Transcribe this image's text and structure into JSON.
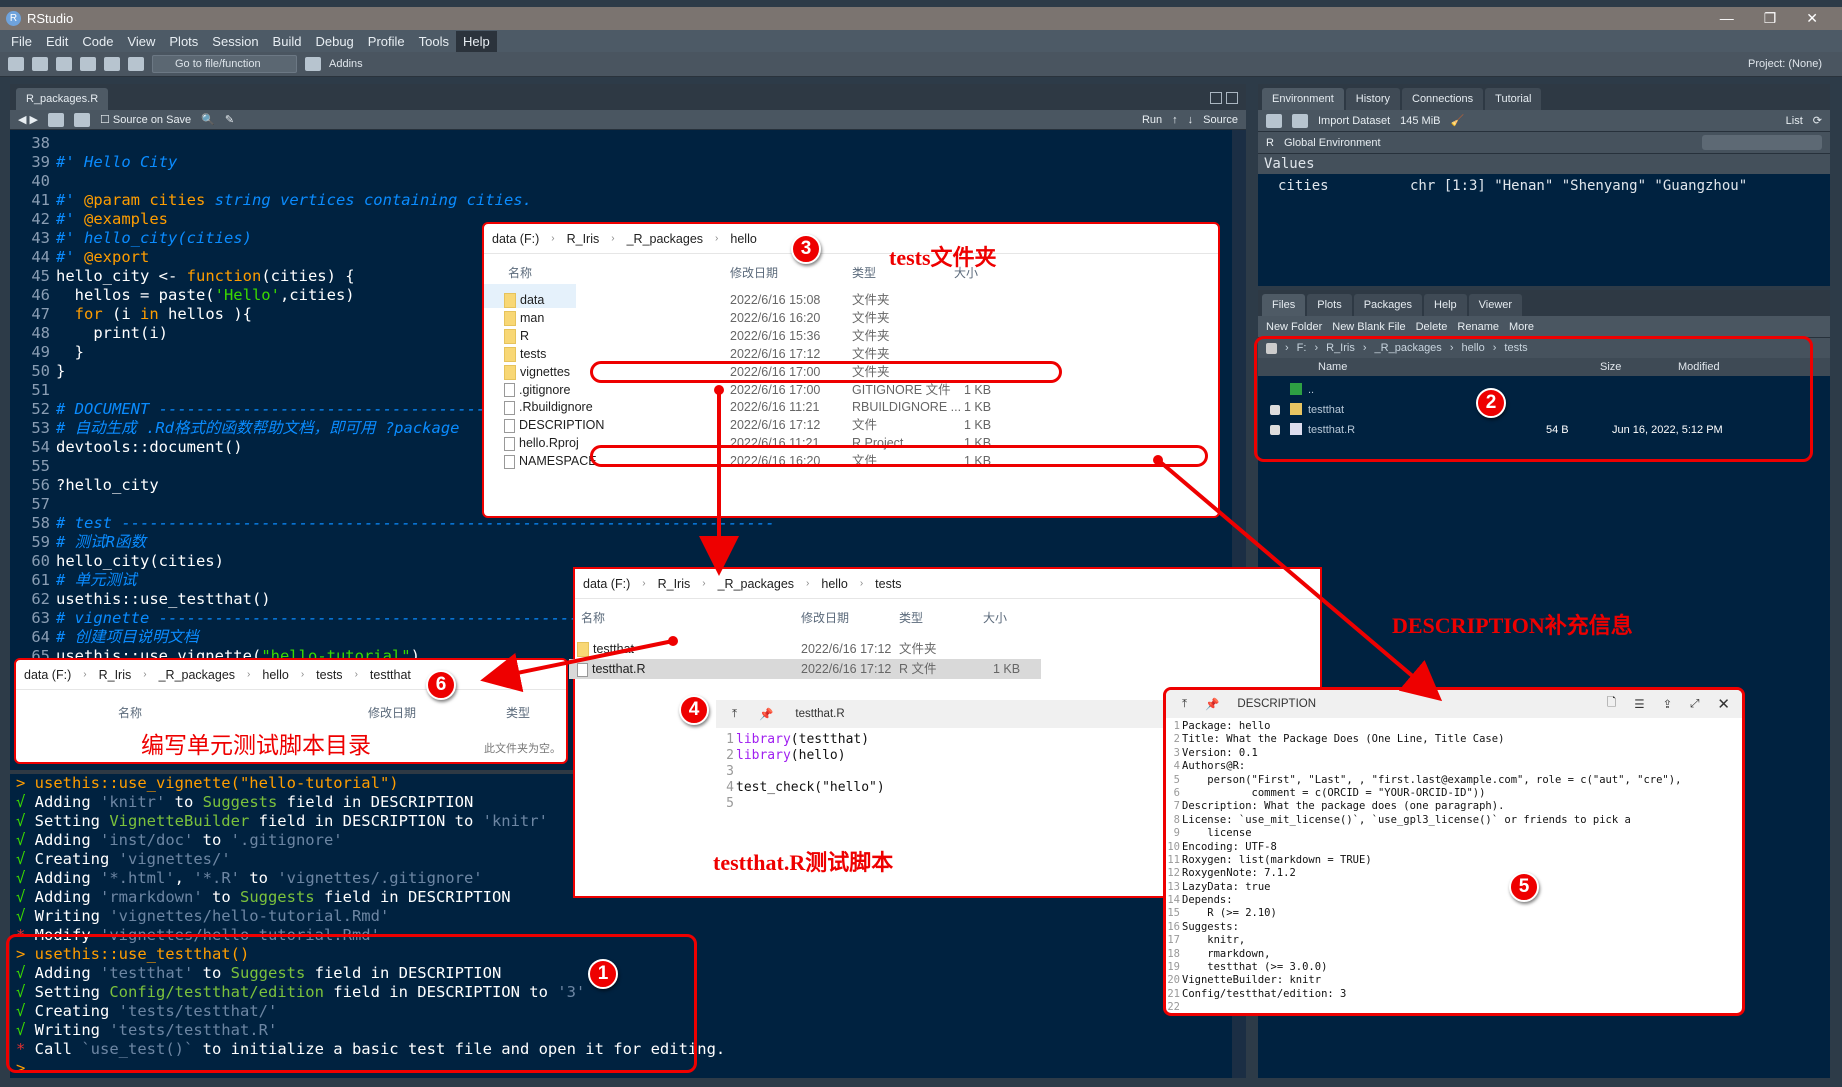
{
  "window": {
    "title": "RStudio",
    "controls": [
      "—",
      "❐",
      "✕"
    ]
  },
  "menu": [
    "File",
    "Edit",
    "Code",
    "View",
    "Plots",
    "Session",
    "Build",
    "Debug",
    "Profile",
    "Tools",
    "Help"
  ],
  "toolbar": {
    "goto": "Go to file/function",
    "addins": "Addins",
    "project": "Project: (None)"
  },
  "editor": {
    "tab": "R_packages.R",
    "source_on_save": "Source on Save",
    "run": "Run",
    "source": "Source",
    "first_line": 38,
    "lines": [
      [],
      [
        [
          "cm",
          "#' Hello City"
        ]
      ],
      [],
      [
        [
          "cm",
          "#' "
        ],
        [
          "tag",
          "@param cities"
        ],
        [
          "cm",
          " string vertices containing cities."
        ]
      ],
      [
        [
          "cm",
          "#' "
        ],
        [
          "tag",
          "@examples"
        ]
      ],
      [
        [
          "cm",
          "#' hello_city(cities)"
        ]
      ],
      [
        [
          "cm",
          "#' "
        ],
        [
          "tag",
          "@export"
        ]
      ],
      [
        [
          "pl",
          "hello_city <- "
        ],
        [
          "kw",
          "function"
        ],
        [
          "pl",
          "(cities) {"
        ]
      ],
      [
        [
          "pl",
          "  hellos = paste("
        ],
        [
          "str",
          "'Hello'"
        ],
        [
          "pl",
          ",cities)"
        ]
      ],
      [
        [
          "pl",
          "  "
        ],
        [
          "kw",
          "for"
        ],
        [
          "pl",
          " (i "
        ],
        [
          "kw",
          "in"
        ],
        [
          "pl",
          " hellos ){"
        ]
      ],
      [
        [
          "pl",
          "    print(i)"
        ]
      ],
      [
        [
          "pl",
          "  }"
        ]
      ],
      [
        [
          "pl",
          "}"
        ]
      ],
      [],
      [
        [
          "cm",
          "# DOCUMENT ------------------------------------------------------------------"
        ]
      ],
      [
        [
          "cm",
          "# 自动生成 .Rd格式的函数帮助文档，即可用 ?package"
        ]
      ],
      [
        [
          "pl",
          "devtools::document()"
        ]
      ],
      [],
      [
        [
          "pl",
          "?hello_city"
        ]
      ],
      [],
      [
        [
          "cm",
          "# test ----------------------------------------------------------------------"
        ]
      ],
      [
        [
          "cm",
          "# 测试R函数"
        ]
      ],
      [
        [
          "pl",
          "hello_city(cities)"
        ]
      ],
      [
        [
          "cm",
          "# 单元测试"
        ]
      ],
      [
        [
          "pl",
          "usethis::use_testthat()"
        ]
      ],
      [
        [
          "cm",
          "# vignette ------------------------------------------------------------------"
        ]
      ],
      [
        [
          "cm",
          "# 创建项目说明文档"
        ]
      ],
      [
        [
          "pl",
          "usethis::use_vignette("
        ],
        [
          "str",
          "\"hello-tutorial\""
        ],
        [
          "pl",
          ")"
        ]
      ]
    ]
  },
  "console": {
    "lines": [
      [
        [
          "prompt",
          "> usethis::use_vignette(\"hello-tutorial\")"
        ]
      ],
      [
        [
          "ok",
          "√ "
        ],
        [
          "pl",
          "Adding "
        ],
        [
          "q",
          "'knitr'"
        ],
        [
          "pl",
          " to "
        ],
        [
          "gr",
          "Suggests"
        ],
        [
          "pl",
          " field in DESCRIPTION"
        ]
      ],
      [
        [
          "ok",
          "√ "
        ],
        [
          "pl",
          "Setting "
        ],
        [
          "gr",
          "VignetteBuilder"
        ],
        [
          "pl",
          " field in DESCRIPTION to "
        ],
        [
          "q",
          "'knitr'"
        ]
      ],
      [
        [
          "ok",
          "√ "
        ],
        [
          "pl",
          "Adding "
        ],
        [
          "q",
          "'inst/doc'"
        ],
        [
          "pl",
          " to "
        ],
        [
          "q",
          "'.gitignore'"
        ]
      ],
      [
        [
          "ok",
          "√ "
        ],
        [
          "pl",
          "Creating "
        ],
        [
          "q",
          "'vignettes/'"
        ]
      ],
      [
        [
          "ok",
          "√ "
        ],
        [
          "pl",
          "Adding "
        ],
        [
          "q",
          "'*.html'"
        ],
        [
          "pl",
          ", "
        ],
        [
          "q",
          "'*.R'"
        ],
        [
          "pl",
          " to "
        ],
        [
          "q",
          "'vignettes/.gitignore'"
        ]
      ],
      [
        [
          "ok",
          "√ "
        ],
        [
          "pl",
          "Adding "
        ],
        [
          "q",
          "'rmarkdown'"
        ],
        [
          "pl",
          " to "
        ],
        [
          "gr",
          "Suggests"
        ],
        [
          "pl",
          " field in DESCRIPTION"
        ]
      ],
      [
        [
          "ok",
          "√ "
        ],
        [
          "pl",
          "Writing "
        ],
        [
          "q",
          "'vignettes/hello-tutorial.Rmd'"
        ]
      ],
      [
        [
          "star",
          "* "
        ],
        [
          "pl",
          "Modify "
        ],
        [
          "q",
          "'vignettes/hello-tutorial.Rmd'"
        ]
      ],
      [
        [
          "prompt",
          "> usethis::use_testthat()"
        ]
      ],
      [
        [
          "ok",
          "√ "
        ],
        [
          "pl",
          "Adding "
        ],
        [
          "q",
          "'testthat'"
        ],
        [
          "pl",
          " to "
        ],
        [
          "gr",
          "Suggests"
        ],
        [
          "pl",
          " field in DESCRIPTION"
        ]
      ],
      [
        [
          "ok",
          "√ "
        ],
        [
          "pl",
          "Setting "
        ],
        [
          "gr",
          "Config/testthat/edition"
        ],
        [
          "pl",
          " field in DESCRIPTION to "
        ],
        [
          "q",
          "'3'"
        ]
      ],
      [
        [
          "ok",
          "√ "
        ],
        [
          "pl",
          "Creating "
        ],
        [
          "q",
          "'tests/testthat/'"
        ]
      ],
      [
        [
          "ok",
          "√ "
        ],
        [
          "pl",
          "Writing "
        ],
        [
          "q",
          "'tests/testthat.R'"
        ]
      ],
      [
        [
          "star",
          "* "
        ],
        [
          "pl",
          "Call "
        ],
        [
          "q",
          "`use_test()`"
        ],
        [
          "pl",
          " to initialize a basic test file and open it for editing."
        ]
      ],
      [
        [
          "prompt",
          "> "
        ]
      ]
    ]
  },
  "environment": {
    "tabs": [
      "Environment",
      "History",
      "Connections",
      "Tutorial"
    ],
    "import": "Import Dataset",
    "memory": "145 MiB",
    "view": "List",
    "lang": "R",
    "scope": "Global Environment",
    "section": "Values",
    "var_name": "cities",
    "var_value": "chr [1:3] \"Henan\" \"Shenyang\" \"Guangzhou\""
  },
  "files": {
    "tabs": [
      "Files",
      "Plots",
      "Packages",
      "Help",
      "Viewer"
    ],
    "actions": [
      "New Folder",
      "New Blank File",
      "Delete",
      "Rename",
      "More"
    ],
    "path": [
      "F:",
      "R_Iris",
      "_R_packages",
      "hello",
      "tests"
    ],
    "cols": [
      "Name",
      "Size",
      "Modified"
    ],
    "rows": [
      {
        "name": "..",
        "size": "",
        "modified": ""
      },
      {
        "name": "testthat",
        "size": "",
        "modified": ""
      },
      {
        "name": "testthat.R",
        "size": "54 B",
        "modified": "Jun 16, 2022, 5:12 PM"
      }
    ]
  },
  "explorer3": {
    "path": [
      "data (F:)",
      "R_Iris",
      "_R_packages",
      "hello"
    ],
    "cols": [
      "名称",
      "修改日期",
      "类型",
      "大小"
    ],
    "rows": [
      {
        "name": "data",
        "date": "2022/6/16 15:08",
        "type": "文件夹",
        "size": "",
        "kind": "folder"
      },
      {
        "name": "man",
        "date": "2022/6/16 16:20",
        "type": "文件夹",
        "size": "",
        "kind": "folder"
      },
      {
        "name": "R",
        "date": "2022/6/16 15:36",
        "type": "文件夹",
        "size": "",
        "kind": "folder"
      },
      {
        "name": "tests",
        "date": "2022/6/16 17:12",
        "type": "文件夹",
        "size": "",
        "kind": "folder"
      },
      {
        "name": "vignettes",
        "date": "2022/6/16 17:00",
        "type": "文件夹",
        "size": "",
        "kind": "folder"
      },
      {
        "name": ".gitignore",
        "date": "2022/6/16 17:00",
        "type": "GITIGNORE 文件",
        "size": "1 KB",
        "kind": "file"
      },
      {
        "name": ".Rbuildignore",
        "date": "2022/6/16 11:21",
        "type": "RBUILDIGNORE ...",
        "size": "1 KB",
        "kind": "file"
      },
      {
        "name": "DESCRIPTION",
        "date": "2022/6/16 17:12",
        "type": "文件",
        "size": "1 KB",
        "kind": "file"
      },
      {
        "name": "hello.Rproj",
        "date": "2022/6/16 11:21",
        "type": "R Project",
        "size": "1 KB",
        "kind": "file"
      },
      {
        "name": "NAMESPACE",
        "date": "2022/6/16 16:20",
        "type": "文件",
        "size": "1 KB",
        "kind": "file"
      }
    ]
  },
  "explorer4": {
    "path": [
      "data (F:)",
      "R_Iris",
      "_R_packages",
      "hello",
      "tests"
    ],
    "cols": [
      "名称",
      "修改日期",
      "类型",
      "大小"
    ],
    "rows": [
      {
        "name": "testthat",
        "date": "2022/6/16 17:12",
        "type": "文件夹",
        "size": "",
        "kind": "folder"
      },
      {
        "name": "testthat.R",
        "date": "2022/6/16 17:12",
        "type": "R 文件",
        "size": "1 KB",
        "kind": "file"
      }
    ]
  },
  "explorer6": {
    "path": [
      "data (F:)",
      "R_Iris",
      "_R_packages",
      "hello",
      "tests",
      "testthat"
    ],
    "cols": [
      "名称",
      "修改日期",
      "类型"
    ],
    "empty": "此文件夹为空。"
  },
  "testthat_viewer": {
    "title": "testthat.R",
    "lines": [
      "library(testthat)",
      "library(hello)",
      "",
      "test_check(\"hello\")",
      ""
    ]
  },
  "description_viewer": {
    "title": "DESCRIPTION",
    "lines": [
      "Package: hello",
      "Title: What the Package Does (One Line, Title Case)",
      "Version: 0.1",
      "Authors@R:",
      "    person(\"First\", \"Last\", , \"first.last@example.com\", role = c(\"aut\", \"cre\"),",
      "           comment = c(ORCID = \"YOUR-ORCID-ID\"))",
      "Description: What the package does (one paragraph).",
      "License: `use_mit_license()`, `use_gpl3_license()` or friends to pick a",
      "    license",
      "Encoding: UTF-8",
      "Roxygen: list(markdown = TRUE)",
      "RoxygenNote: 7.1.2",
      "LazyData: true",
      "Depends:",
      "    R (>= 2.10)",
      "Suggests:",
      "    knitr,",
      "    rmarkdown,",
      "    testthat (>= 3.0.0)",
      "VignetteBuilder: knitr",
      "Config/testthat/edition: 3",
      ""
    ]
  },
  "annotations": {
    "a3": "tests文件夹",
    "a5": "DESCRIPTION补充信息",
    "a4": "testthat.R测试脚本",
    "a6": "编写单元测试脚本目录",
    "badges": [
      "1",
      "2",
      "3",
      "4",
      "5",
      "6"
    ]
  },
  "colors": {
    "editor_bg": "#002240",
    "annotation": "#ee0000",
    "comment": "#0a8cff",
    "keyword": "#ff9d00",
    "string": "#3ad900"
  }
}
